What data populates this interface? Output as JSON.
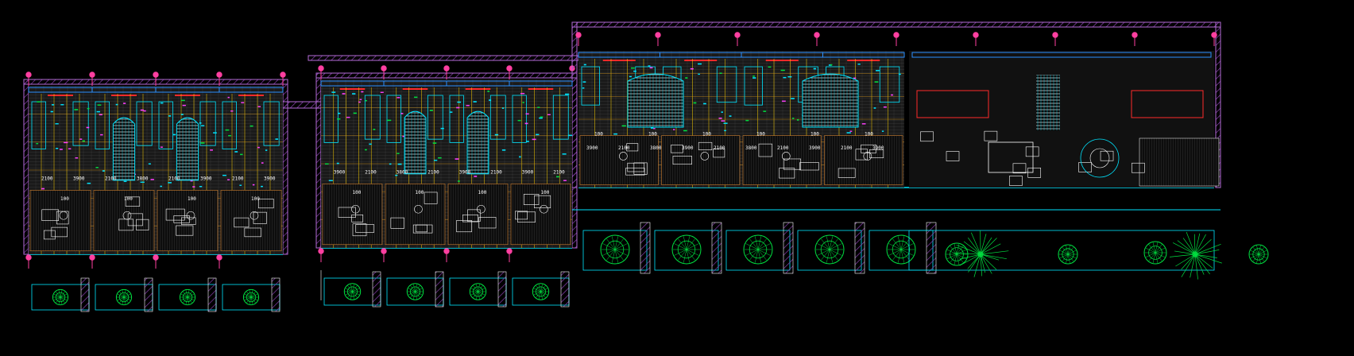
{
  "drawing": {
    "background": "#000000",
    "colors": {
      "wall": "#b36bd6",
      "hatch": "#8a3fb0",
      "column": "#ff3fa0",
      "grid": "#ffd400",
      "dim_line": "#e0a020",
      "fixture": "#00e5ff",
      "furniture": "#ffffff",
      "plant": "#00e040",
      "glazing": "#2a8fff",
      "accent_red": "#ff2a2a",
      "floor_line": "#d08030"
    }
  },
  "blocks": [
    {
      "name": "block-left",
      "units": 4,
      "dims": [
        "2100",
        "3900",
        "2100",
        "3800",
        "2100",
        "3900",
        "2100",
        "3900"
      ],
      "low_dims": [
        "100",
        "100",
        "100",
        "100"
      ]
    },
    {
      "name": "block-middle",
      "units": 4,
      "dims": [
        "3900",
        "2100",
        "3800",
        "2100",
        "3900",
        "2100",
        "3900",
        "2100"
      ],
      "low_dims": [
        "100",
        "100",
        "100",
        "100"
      ]
    },
    {
      "name": "block-right",
      "units": 8,
      "dims": [
        "3900",
        "2100",
        "3800",
        "3900",
        "2100",
        "3800",
        "2100",
        "3900",
        "2100",
        "3900"
      ],
      "low_dims": [
        "100",
        "100",
        "100",
        "100",
        "100",
        "100"
      ]
    }
  ]
}
